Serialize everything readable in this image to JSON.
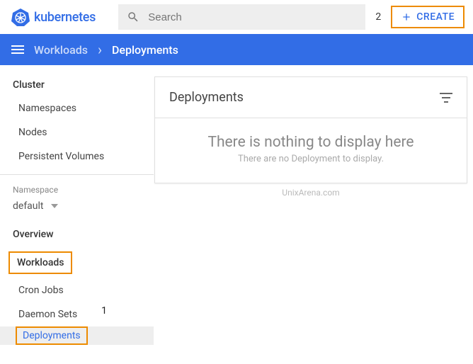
{
  "brand": "kubernetes",
  "search": {
    "placeholder": "Search"
  },
  "annotations": {
    "two": "2",
    "one": "1"
  },
  "createButton": {
    "label": "CREATE"
  },
  "breadcrumb": {
    "parent": "Workloads",
    "current": "Deployments"
  },
  "sidebar": {
    "clusterTitle": "Cluster",
    "clusterItems": [
      "Namespaces",
      "Nodes",
      "Persistent Volumes"
    ],
    "namespaceLabel": "Namespace",
    "namespaceValue": "default",
    "overview": "Overview",
    "workloadsTitle": "Workloads",
    "workloadsItems": [
      "Cron Jobs",
      "Daemon Sets",
      "Deployments"
    ]
  },
  "card": {
    "title": "Deployments",
    "emptyTitle": "There is nothing to display here",
    "emptySub": "There are no Deployment to display."
  },
  "watermark": "UnixArena.com"
}
